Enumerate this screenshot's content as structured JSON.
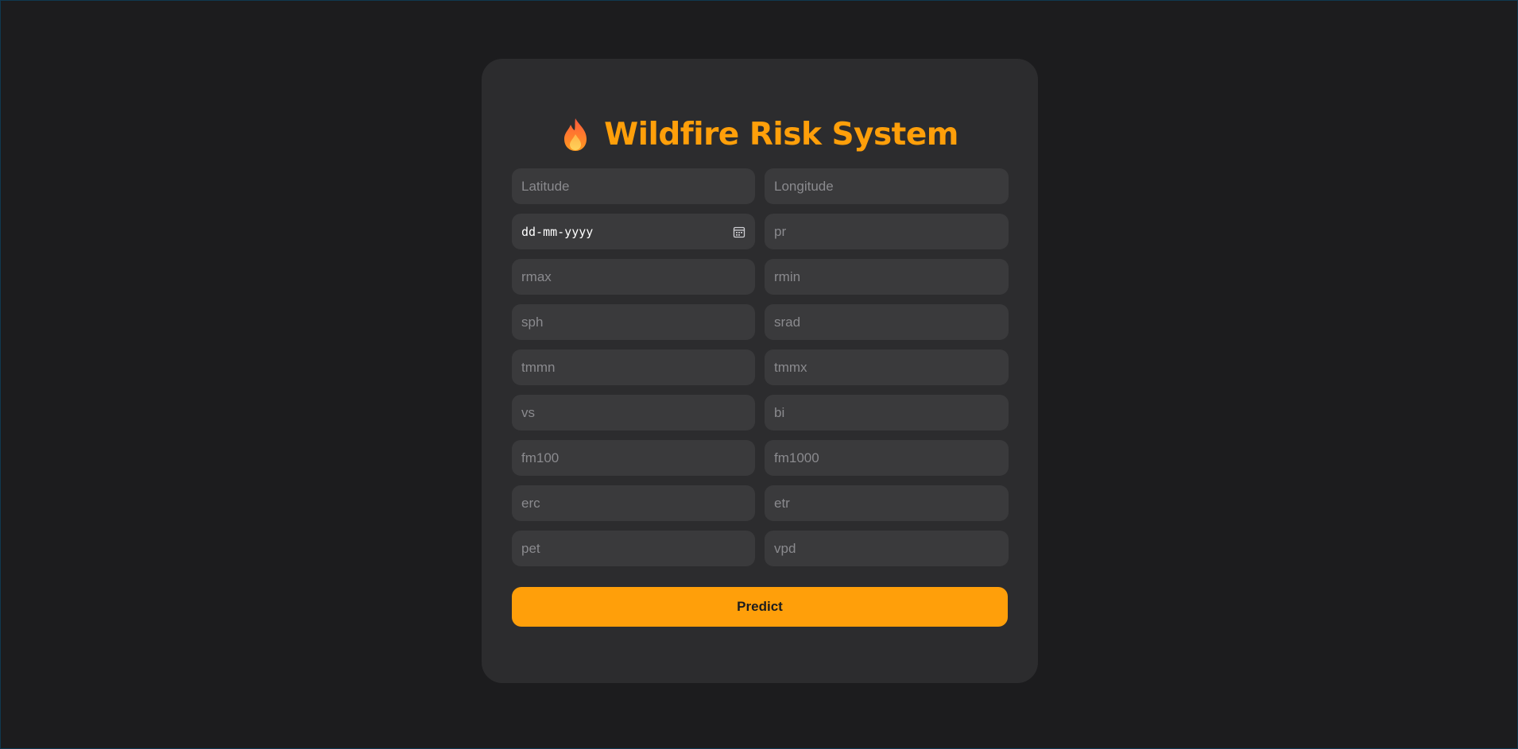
{
  "app": {
    "title": "Wildfire Risk System",
    "title_icon": "flame-icon",
    "accent_color": "#ff9f0a"
  },
  "form": {
    "fields": [
      {
        "name": "latitude",
        "placeholder": "Latitude"
      },
      {
        "name": "longitude",
        "placeholder": "Longitude"
      },
      {
        "name": "date",
        "placeholder": "dd-mm-yyyy",
        "type": "date"
      },
      {
        "name": "pr",
        "placeholder": "pr"
      },
      {
        "name": "rmax",
        "placeholder": "rmax"
      },
      {
        "name": "rmin",
        "placeholder": "rmin"
      },
      {
        "name": "sph",
        "placeholder": "sph"
      },
      {
        "name": "srad",
        "placeholder": "srad"
      },
      {
        "name": "tmmn",
        "placeholder": "tmmn"
      },
      {
        "name": "tmmx",
        "placeholder": "tmmx"
      },
      {
        "name": "vs",
        "placeholder": "vs"
      },
      {
        "name": "bi",
        "placeholder": "bi"
      },
      {
        "name": "fm100",
        "placeholder": "fm100"
      },
      {
        "name": "fm1000",
        "placeholder": "fm1000"
      },
      {
        "name": "erc",
        "placeholder": "erc"
      },
      {
        "name": "etr",
        "placeholder": "etr"
      },
      {
        "name": "pet",
        "placeholder": "pet"
      },
      {
        "name": "vpd",
        "placeholder": "vpd"
      }
    ],
    "date_icon": "calendar-icon",
    "submit_label": "Predict"
  }
}
